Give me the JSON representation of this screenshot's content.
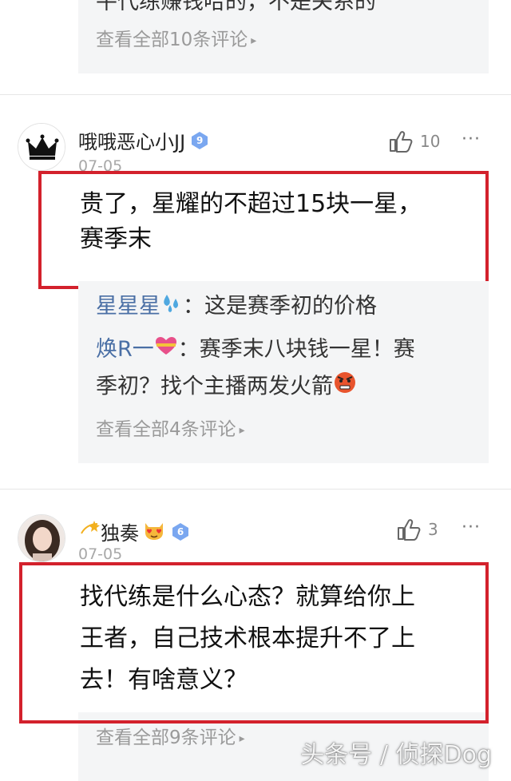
{
  "top_thread": {
    "cut_text": "平代练赚钱哈的，不是关系的",
    "view_all": "查看全部10条评论"
  },
  "comments": [
    {
      "username": "哦哦恶心小JJ",
      "level": "9",
      "date": "07-05",
      "likes": "10",
      "text_lines": [
        "贵了，星耀的不超过15块一星，",
        "赛季末"
      ],
      "replies": [
        {
          "user": "星星星",
          "text": "：这是赛季初的价格",
          "emoji": "sweat-droplets-icon"
        },
        {
          "user": "焕R一",
          "text": "：赛季末八块钱一星！赛",
          "emoji": "heart-ribbon-icon",
          "cont": "季初？找个主播两发火箭"
        }
      ],
      "view_all": "查看全部4条评论"
    },
    {
      "username": "独奏",
      "level": "6",
      "date": "07-05",
      "likes": "3",
      "text_lines": [
        "找代练是什么心态？就算给你上",
        "王者，自己技术根本提升不了上",
        "去！有啥意义？"
      ],
      "view_all": "查看全部9条评论"
    }
  ],
  "watermark": "头条号 / 侦探Dog",
  "colors": {
    "highlight": "#d3212c",
    "reply_user": "#4a6fa5",
    "badge": "#7aa7f0",
    "reply_bg": "#f4f5f6"
  }
}
